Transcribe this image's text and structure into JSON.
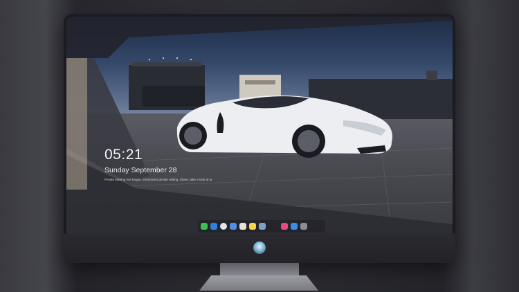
{
  "lockscreen": {
    "time": "05:21",
    "date": "Sunday September  28",
    "notification": "Private viewing has begun. Everyone's private setting. Share, take a  look at tu"
  },
  "dock": {
    "icons": [
      {
        "name": "messages-icon",
        "color": "#3fbf4f"
      },
      {
        "name": "mail-icon",
        "color": "#2f7fe0"
      },
      {
        "name": "safari-icon",
        "color": "#dfe6ee"
      },
      {
        "name": "finder-icon",
        "color": "#4f8fe8"
      },
      {
        "name": "photos-icon",
        "color": "#e9e2d4"
      },
      {
        "name": "notes-icon",
        "color": "#f4d44a"
      },
      {
        "name": "preview-icon",
        "color": "#7aa4c4"
      },
      {
        "name": "music-icon",
        "color": "#e34a8a"
      },
      {
        "name": "app-store-icon",
        "color": "#3a8de8"
      },
      {
        "name": "camera-icon",
        "color": "#8c8c92"
      }
    ]
  },
  "colors": {
    "sky": "#34486a",
    "car": "#eceef2",
    "monitor_frame": "#1c1c20"
  }
}
